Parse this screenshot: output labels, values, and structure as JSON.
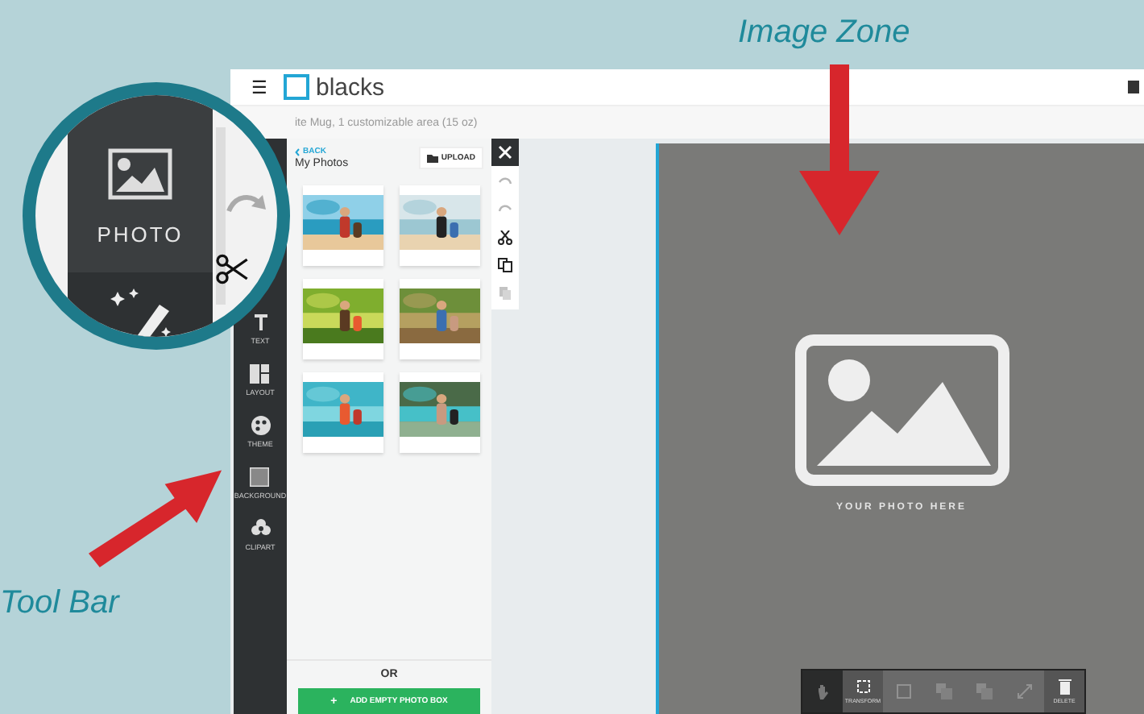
{
  "callouts": {
    "image_zone": "Image Zone",
    "tool_bar": "Tool Bar"
  },
  "header": {
    "menu": "☰",
    "logo": "blacks"
  },
  "product": "ite Mug, 1 customizable area (15 oz)",
  "magnifier": {
    "label": "PHOTO"
  },
  "toolbar": [
    {
      "label": "TEXT",
      "kind": "text"
    },
    {
      "label": "LAYOUT",
      "kind": "layout"
    },
    {
      "label": "THEME",
      "kind": "theme"
    },
    {
      "label": "BACKGROUND",
      "kind": "background"
    },
    {
      "label": "CLIPART",
      "kind": "clipart"
    }
  ],
  "panel": {
    "back": "BACK",
    "title": "My Photos",
    "upload": "UPLOAD",
    "or": "OR",
    "add_icon": "+",
    "add_button": "ADD EMPTY PHOTO BOX"
  },
  "edit_tools": [
    {
      "kind": "undo",
      "disabled": true
    },
    {
      "kind": "redo",
      "disabled": true
    },
    {
      "kind": "cut",
      "disabled": false
    },
    {
      "kind": "copy",
      "disabled": false
    },
    {
      "kind": "paste",
      "disabled": true
    }
  ],
  "image_zone": {
    "placeholder": "YOUR PHOTO HERE"
  },
  "floating_toolbar": [
    {
      "kind": "move",
      "disabled": false
    },
    {
      "kind": "transform",
      "label": "TRANSFORM",
      "disabled": false
    },
    {
      "kind": "crop",
      "disabled": true
    },
    {
      "kind": "front",
      "disabled": true
    },
    {
      "kind": "back",
      "disabled": true
    },
    {
      "kind": "resize",
      "disabled": true
    },
    {
      "kind": "delete",
      "label": "DELETE",
      "disabled": false
    }
  ]
}
